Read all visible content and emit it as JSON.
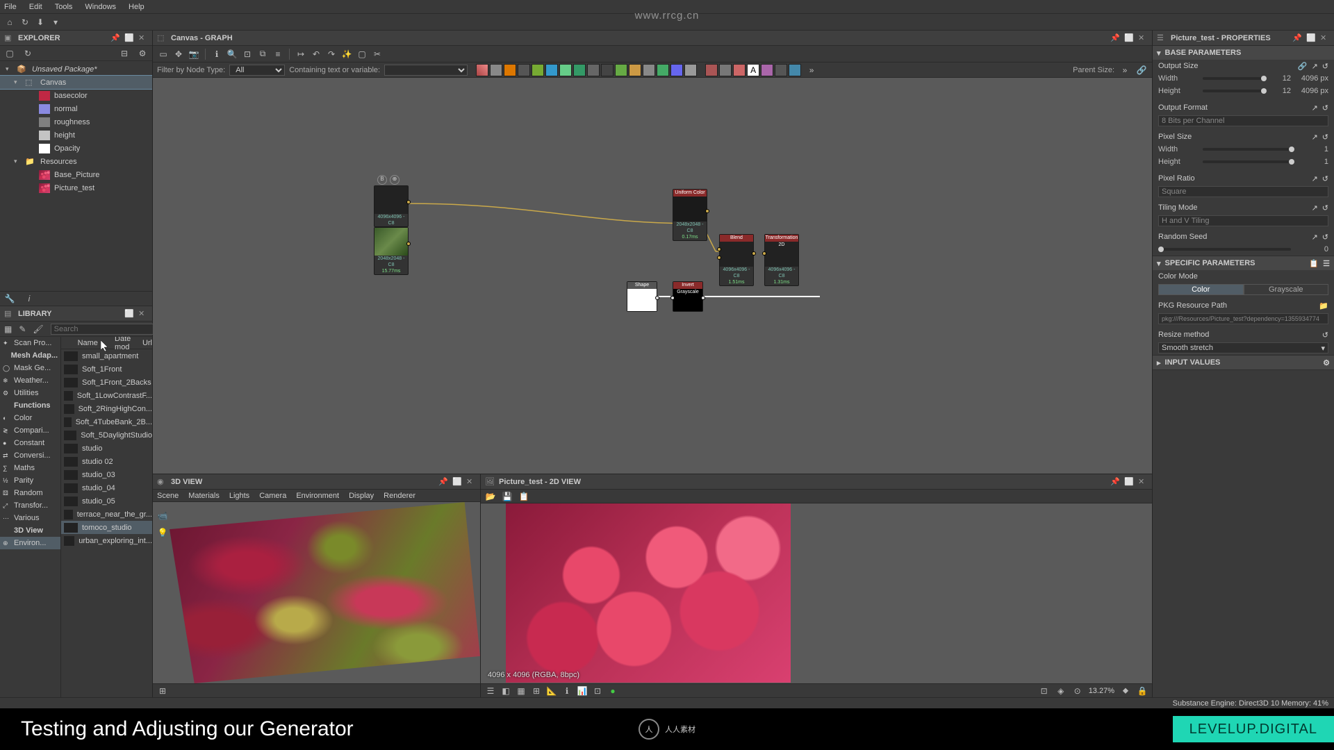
{
  "menubar": [
    "File",
    "Edit",
    "Tools",
    "Windows",
    "Help"
  ],
  "watermark": "www.rrcg.cn",
  "explorer": {
    "title": "EXPLORER",
    "package": "Unsaved Package*",
    "graph": "Canvas",
    "channels": [
      {
        "name": "basecolor",
        "color": "#c02844"
      },
      {
        "name": "normal",
        "color": "#8a8ae0"
      },
      {
        "name": "roughness",
        "color": "#808080"
      },
      {
        "name": "height",
        "color": "#c4c4c4"
      },
      {
        "name": "Opacity",
        "color": "#ffffff"
      }
    ],
    "resources_label": "Resources",
    "resources": [
      {
        "name": "Base_Picture"
      },
      {
        "name": "Picture_test"
      }
    ]
  },
  "library": {
    "title": "LIBRARY",
    "search_placeholder": "Search",
    "cols": [
      "Name",
      "Date mod",
      "Url"
    ],
    "cats": [
      {
        "label": "Scan Pro...",
        "icon": "✦"
      },
      {
        "label": "Mesh Adap...",
        "icon": "",
        "hdr": true
      },
      {
        "label": "Mask Ge...",
        "icon": "◯"
      },
      {
        "label": "Weather...",
        "icon": "❄"
      },
      {
        "label": "Utilities",
        "icon": "⚙"
      },
      {
        "label": "Functions",
        "icon": "",
        "hdr": true
      },
      {
        "label": "Color",
        "icon": "◐"
      },
      {
        "label": "Compari...",
        "icon": "≷"
      },
      {
        "label": "Constant",
        "icon": "●"
      },
      {
        "label": "Conversi...",
        "icon": "⇄"
      },
      {
        "label": "Maths",
        "icon": "∑"
      },
      {
        "label": "Parity",
        "icon": "½"
      },
      {
        "label": "Random",
        "icon": "⚄"
      },
      {
        "label": "Transfor...",
        "icon": "⤢"
      },
      {
        "label": "Various",
        "icon": "⋯"
      },
      {
        "label": "3D View",
        "icon": "",
        "hdr": true
      },
      {
        "label": "Environ...",
        "icon": "⊕",
        "sel": true
      }
    ],
    "items": [
      "small_apartment",
      "Soft_1Front",
      "Soft_1Front_2Backs",
      "Soft_1LowContrastF...",
      "Soft_2RingHighCon...",
      "Soft_4TubeBank_2B...",
      "Soft_5DaylightStudio",
      "studio",
      "studio 02",
      "studio_03",
      "studio_04",
      "studio_05",
      "terrace_near_the_gr...",
      "tomoco_studio",
      "urban_exploring_int..."
    ],
    "selected": "tomoco_studio"
  },
  "canvas": {
    "title": "Canvas - GRAPH",
    "filter_label": "Filter by Node Type:",
    "filter_value": "All",
    "contain_label": "Containing text or variable:",
    "parent_label": "Parent Size:",
    "nodes": {
      "bitmap1": {
        "size": "4096x4096 - C8",
        "time": ""
      },
      "bitmap2": {
        "size": "2048x2048 - C8",
        "time": "15.77ms"
      },
      "uniform": {
        "title": "Uniform Color",
        "size": "2048x2048 - C8",
        "time": "0.17ms"
      },
      "blend": {
        "title": "Blend",
        "size": "4096x4096 - C8",
        "time": "1.51ms"
      },
      "trans": {
        "title": "Transformation 2D",
        "size": "4096x4096 - C8",
        "time": "1.31ms"
      },
      "shape": {
        "title": "Shape"
      },
      "invert": {
        "title": "Invert Grayscale"
      }
    }
  },
  "view3d": {
    "title": "3D VIEW",
    "menu": [
      "Scene",
      "Materials",
      "Lights",
      "Camera",
      "Environment",
      "Display",
      "Renderer"
    ]
  },
  "view2d": {
    "title": "Picture_test - 2D VIEW",
    "info": "4096 x 4096 (RGBA, 8bpc)",
    "zoom": "13.27%"
  },
  "properties": {
    "title": "Picture_test - PROPERTIES",
    "base_params": "BASE PARAMETERS",
    "output_size": "Output Size",
    "width": "Width",
    "height": "Height",
    "size_val": "12",
    "size_px": "4096 px",
    "output_format": "Output Format",
    "format_val": "8 Bits per Channel",
    "pixel_size": "Pixel Size",
    "ps_val": "1",
    "pixel_ratio": "Pixel Ratio",
    "ratio_val": "Square",
    "tiling": "Tiling Mode",
    "tiling_val": "H and V Tiling",
    "seed": "Random Seed",
    "seed_val": "0",
    "specific": "SPECIFIC PARAMETERS",
    "color_mode": "Color Mode",
    "color": "Color",
    "grayscale": "Grayscale",
    "pkg": "PKG Resource Path",
    "pkg_val": "pkg:///Resources/Picture_test?dependency=1355934774",
    "resize": "Resize method",
    "resize_val": "Smooth stretch",
    "input_values": "INPUT VALUES"
  },
  "status": "Substance Engine: Direct3D 10   Memory: 41%",
  "caption": "Testing and Adjusting our Generator",
  "center_logo": "人人素材",
  "brand": "LEVELUP.DIGITAL"
}
